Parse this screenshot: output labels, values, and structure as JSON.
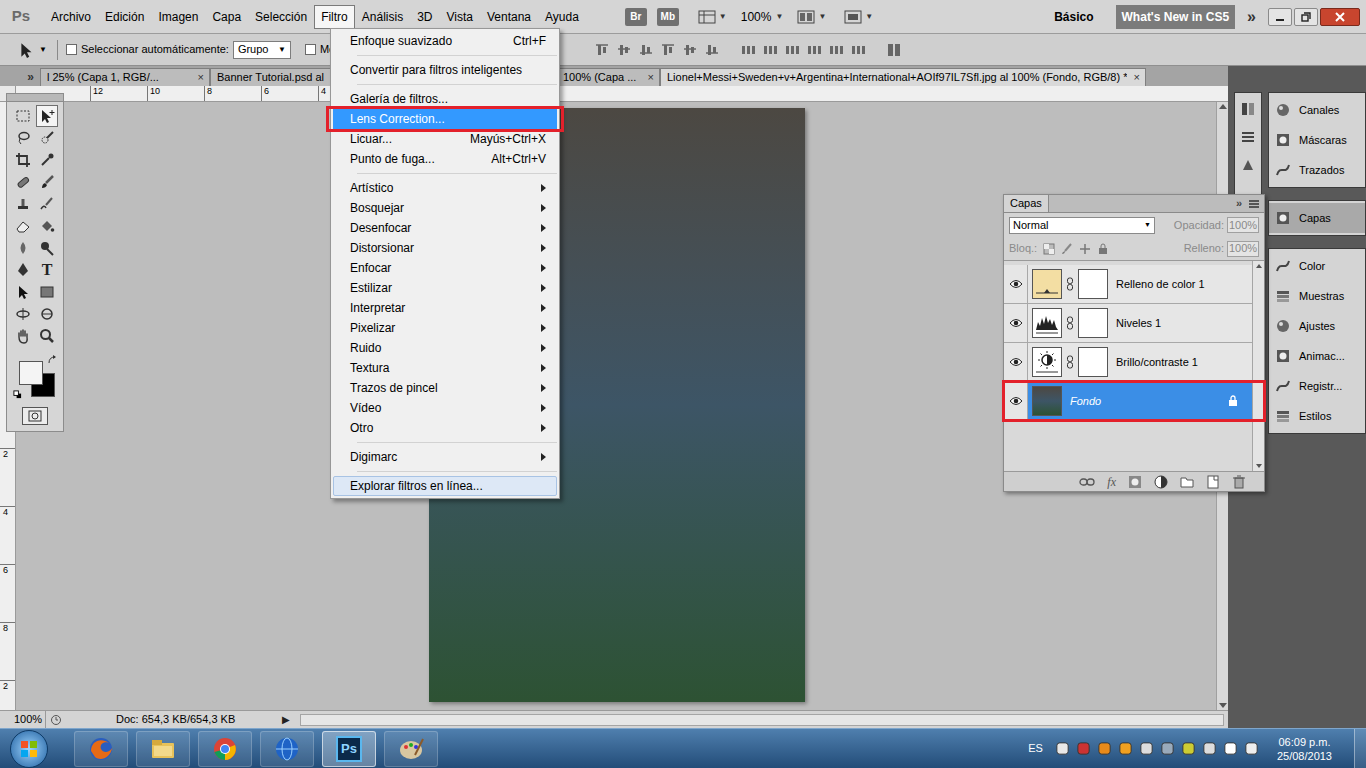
{
  "app": {
    "logo": "Ps"
  },
  "menubar": {
    "items": [
      {
        "label": "Archivo",
        "selected": false
      },
      {
        "label": "Edición",
        "selected": false
      },
      {
        "label": "Imagen",
        "selected": false
      },
      {
        "label": "Capa",
        "selected": false
      },
      {
        "label": "Selección",
        "selected": false
      },
      {
        "label": "Filtro",
        "selected": true
      },
      {
        "label": "Análisis",
        "selected": false
      },
      {
        "label": "3D",
        "selected": false
      },
      {
        "label": "Vista",
        "selected": false
      },
      {
        "label": "Ventana",
        "selected": false
      },
      {
        "label": "Ayuda",
        "selected": false
      }
    ],
    "bridge": "Br",
    "mini_bridge": "Mb",
    "zoom": "100%",
    "dropdown_arrow": "▼",
    "workspace": "Básico",
    "whats_new": "What's New in CS5",
    "more": "»"
  },
  "options_bar": {
    "tool_arrow": "▼",
    "auto_select": {
      "label": "Seleccionar automáticamente:",
      "checked": false
    },
    "mode": {
      "value": "Grupo",
      "arrow": "▼"
    },
    "show_controls": {
      "label": "Most",
      "checked": false
    }
  },
  "tabs": {
    "scroll": "»",
    "items": [
      {
        "label": "l 25% (Capa 1, RGB/...",
        "close": "×",
        "selected": false
      },
      {
        "label": "Banner Tutorial.psd al",
        "close": "",
        "selected": false
      },
      {
        "label": "100% (Capa ...",
        "close": "×",
        "selected": false
      },
      {
        "label": "Lionel+Messi+Sweden+v+Argentina+International+AOIf97IL7Sfl.jpg al 100% (Fondo, RGB/8) *",
        "close": "×",
        "selected": true
      }
    ]
  },
  "rulers": {
    "top": [
      "12",
      "10",
      "8",
      "6",
      "4"
    ],
    "left": [
      "2",
      "4",
      "6",
      "8",
      "2"
    ]
  },
  "toolbox": {
    "tools": [
      {
        "kind": "marquee",
        "selected": false
      },
      {
        "kind": "move",
        "selected": true
      },
      {
        "kind": "lasso",
        "selected": false
      },
      {
        "kind": "quick",
        "selected": false
      },
      {
        "kind": "crop",
        "selected": false
      },
      {
        "kind": "eyedropper",
        "selected": false
      },
      {
        "kind": "heal",
        "selected": false
      },
      {
        "kind": "brush",
        "selected": false
      },
      {
        "kind": "stamp",
        "selected": false
      },
      {
        "kind": "history",
        "selected": false
      },
      {
        "kind": "eraser",
        "selected": false
      },
      {
        "kind": "bucket",
        "selected": false
      },
      {
        "kind": "blur",
        "selected": false
      },
      {
        "kind": "dodge",
        "selected": false
      },
      {
        "kind": "pen",
        "selected": false
      },
      {
        "kind": "type",
        "selected": false,
        "glyph": "T"
      },
      {
        "kind": "path",
        "selected": false
      },
      {
        "kind": "shape",
        "selected": false
      },
      {
        "kind": "rotate3d",
        "selected": false
      },
      {
        "kind": "orbit3d",
        "selected": false
      },
      {
        "kind": "hand",
        "selected": false
      },
      {
        "kind": "zoom",
        "selected": false
      }
    ]
  },
  "filter_menu": {
    "groups": [
      [
        {
          "label": "Enfoque suavizado",
          "shortcut": "Ctrl+F",
          "submenu": false,
          "selected": false,
          "highlighted": false,
          "annotated": false
        }
      ],
      [
        {
          "label": "Convertir para filtros inteligentes",
          "shortcut": "",
          "submenu": false,
          "selected": false,
          "highlighted": false,
          "annotated": false
        }
      ],
      [
        {
          "label": "Galería de filtros...",
          "shortcut": "",
          "submenu": false,
          "selected": false,
          "highlighted": false,
          "annotated": false
        },
        {
          "label": "Lens Correction...",
          "shortcut": "",
          "submenu": false,
          "selected": true,
          "highlighted": false,
          "annotated": true
        },
        {
          "label": "Licuar...",
          "shortcut": "Mayús+Ctrl+X",
          "submenu": false,
          "selected": false,
          "highlighted": false,
          "annotated": false
        },
        {
          "label": "Punto de fuga...",
          "shortcut": "Alt+Ctrl+V",
          "submenu": false,
          "selected": false,
          "highlighted": false,
          "annotated": false
        }
      ],
      [
        {
          "label": "Artístico",
          "shortcut": "",
          "submenu": true,
          "selected": false,
          "highlighted": false,
          "annotated": false
        },
        {
          "label": "Bosquejar",
          "shortcut": "",
          "submenu": true,
          "selected": false,
          "highlighted": false,
          "annotated": false
        },
        {
          "label": "Desenfocar",
          "shortcut": "",
          "submenu": true,
          "selected": false,
          "highlighted": false,
          "annotated": false
        },
        {
          "label": "Distorsionar",
          "shortcut": "",
          "submenu": true,
          "selected": false,
          "highlighted": false,
          "annotated": false
        },
        {
          "label": "Enfocar",
          "shortcut": "",
          "submenu": true,
          "selected": false,
          "highlighted": false,
          "annotated": false
        },
        {
          "label": "Estilizar",
          "shortcut": "",
          "submenu": true,
          "selected": false,
          "highlighted": false,
          "annotated": false
        },
        {
          "label": "Interpretar",
          "shortcut": "",
          "submenu": true,
          "selected": false,
          "highlighted": false,
          "annotated": false
        },
        {
          "label": "Pixelizar",
          "shortcut": "",
          "submenu": true,
          "selected": false,
          "highlighted": false,
          "annotated": false
        },
        {
          "label": "Ruido",
          "shortcut": "",
          "submenu": true,
          "selected": false,
          "highlighted": false,
          "annotated": false
        },
        {
          "label": "Textura",
          "shortcut": "",
          "submenu": true,
          "selected": false,
          "highlighted": false,
          "annotated": false
        },
        {
          "label": "Trazos de pincel",
          "shortcut": "",
          "submenu": true,
          "selected": false,
          "highlighted": false,
          "annotated": false
        },
        {
          "label": "Vídeo",
          "shortcut": "",
          "submenu": true,
          "selected": false,
          "highlighted": false,
          "annotated": false
        },
        {
          "label": "Otro",
          "shortcut": "",
          "submenu": true,
          "selected": false,
          "highlighted": false,
          "annotated": false
        }
      ],
      [
        {
          "label": "Digimarc",
          "shortcut": "",
          "submenu": true,
          "selected": false,
          "highlighted": false,
          "annotated": false
        }
      ],
      [
        {
          "label": "Explorar filtros en línea...",
          "shortcut": "",
          "submenu": false,
          "selected": false,
          "highlighted": true,
          "annotated": false
        }
      ]
    ]
  },
  "layers_panel": {
    "title": "Capas",
    "collapse": "»",
    "blend_mode": "Normal",
    "blend_arrow": "▼",
    "opacity": {
      "label": "Opacidad:",
      "value": "100%",
      "disabled": true
    },
    "lock_label": "Bloq.:",
    "fill": {
      "label": "Relleno:",
      "value": "100%",
      "disabled": true
    },
    "footer_fx": "fx",
    "layers": [
      {
        "name": "Relleno de color 1",
        "kind": "fill",
        "visible": true,
        "selected": false,
        "locked": false,
        "annotated": false
      },
      {
        "name": "Niveles 1",
        "kind": "levels",
        "visible": true,
        "selected": false,
        "locked": false,
        "annotated": false
      },
      {
        "name": "Brillo/contraste 1",
        "kind": "brightness",
        "visible": true,
        "selected": false,
        "locked": false,
        "annotated": false
      },
      {
        "name": "Fondo",
        "kind": "image",
        "visible": true,
        "selected": true,
        "locked": true,
        "annotated": true
      }
    ]
  },
  "dock": {
    "groups": [
      [
        {
          "label": "Canales",
          "selected": false
        },
        {
          "label": "Máscaras",
          "selected": false
        },
        {
          "label": "Trazados",
          "selected": false
        }
      ],
      [
        {
          "label": "Capas",
          "selected": true
        }
      ],
      [
        {
          "label": "Color",
          "selected": false
        },
        {
          "label": "Muestras",
          "selected": false
        },
        {
          "label": "Ajustes",
          "selected": false
        },
        {
          "label": "Animac...",
          "selected": false
        },
        {
          "label": "Registr...",
          "selected": false
        },
        {
          "label": "Estilos",
          "selected": false
        }
      ]
    ]
  },
  "status_bar": {
    "zoom": "100%",
    "doc": "Doc: 654,3 KB/654,3 KB",
    "arrow": "▶"
  },
  "taskbar": {
    "apps": [
      {
        "kind": "firefox",
        "label": "",
        "active": false
      },
      {
        "kind": "explorer",
        "label": "",
        "active": false
      },
      {
        "kind": "chrome",
        "label": "",
        "active": false
      },
      {
        "kind": "globe",
        "label": "",
        "active": false
      },
      {
        "kind": "photoshop",
        "label": "Ps",
        "active": true
      },
      {
        "kind": "paint",
        "label": "",
        "active": false
      }
    ],
    "language": "ES",
    "time": "06:09 p.m.",
    "date": "25/08/2013"
  }
}
